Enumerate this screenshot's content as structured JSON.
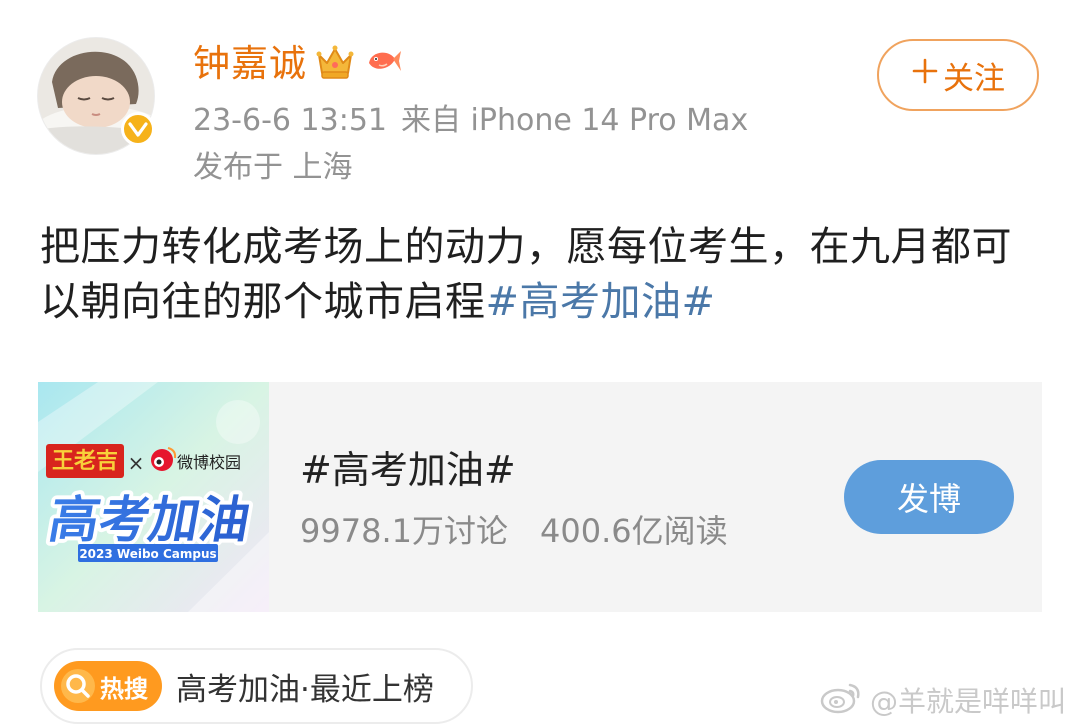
{
  "post": {
    "author": {
      "name": "钟嘉诚",
      "badges": [
        "crown-icon",
        "koi-fish-icon"
      ],
      "verified_badge": "verified-v-icon"
    },
    "timestamp": "23-6-6 13:51",
    "source": "来自 iPhone 14 Pro Max",
    "location": "发布于 上海",
    "follow_button": {
      "icon": "plus",
      "label": "关注"
    },
    "text_main": "把压力转化成考场上的动力，愿每位考生，在九月都可以朝向往的那个城市启程",
    "hashtag": "#高考加油#"
  },
  "topic_card": {
    "cover": {
      "brand_left": "王老吉",
      "cross": "×",
      "brand_right": "微博校园",
      "headline": "高考加油",
      "footer": "2023 Weibo Campus"
    },
    "title": "#高考加油#",
    "discussions": "9978.1万讨论",
    "reads": "400.6亿阅读",
    "post_button": "发博"
  },
  "hot_search": {
    "badge": "热搜",
    "text": "高考加油·最近上榜"
  },
  "watermark": {
    "text": "@羊就是咩咩叫"
  },
  "colors": {
    "username": "#e8720c",
    "meta": "#939393",
    "hashtag": "#4b78a8",
    "post_button": "#5e9edc",
    "hot_badge": "#ff9a1f",
    "verified": "#f6b21a"
  }
}
